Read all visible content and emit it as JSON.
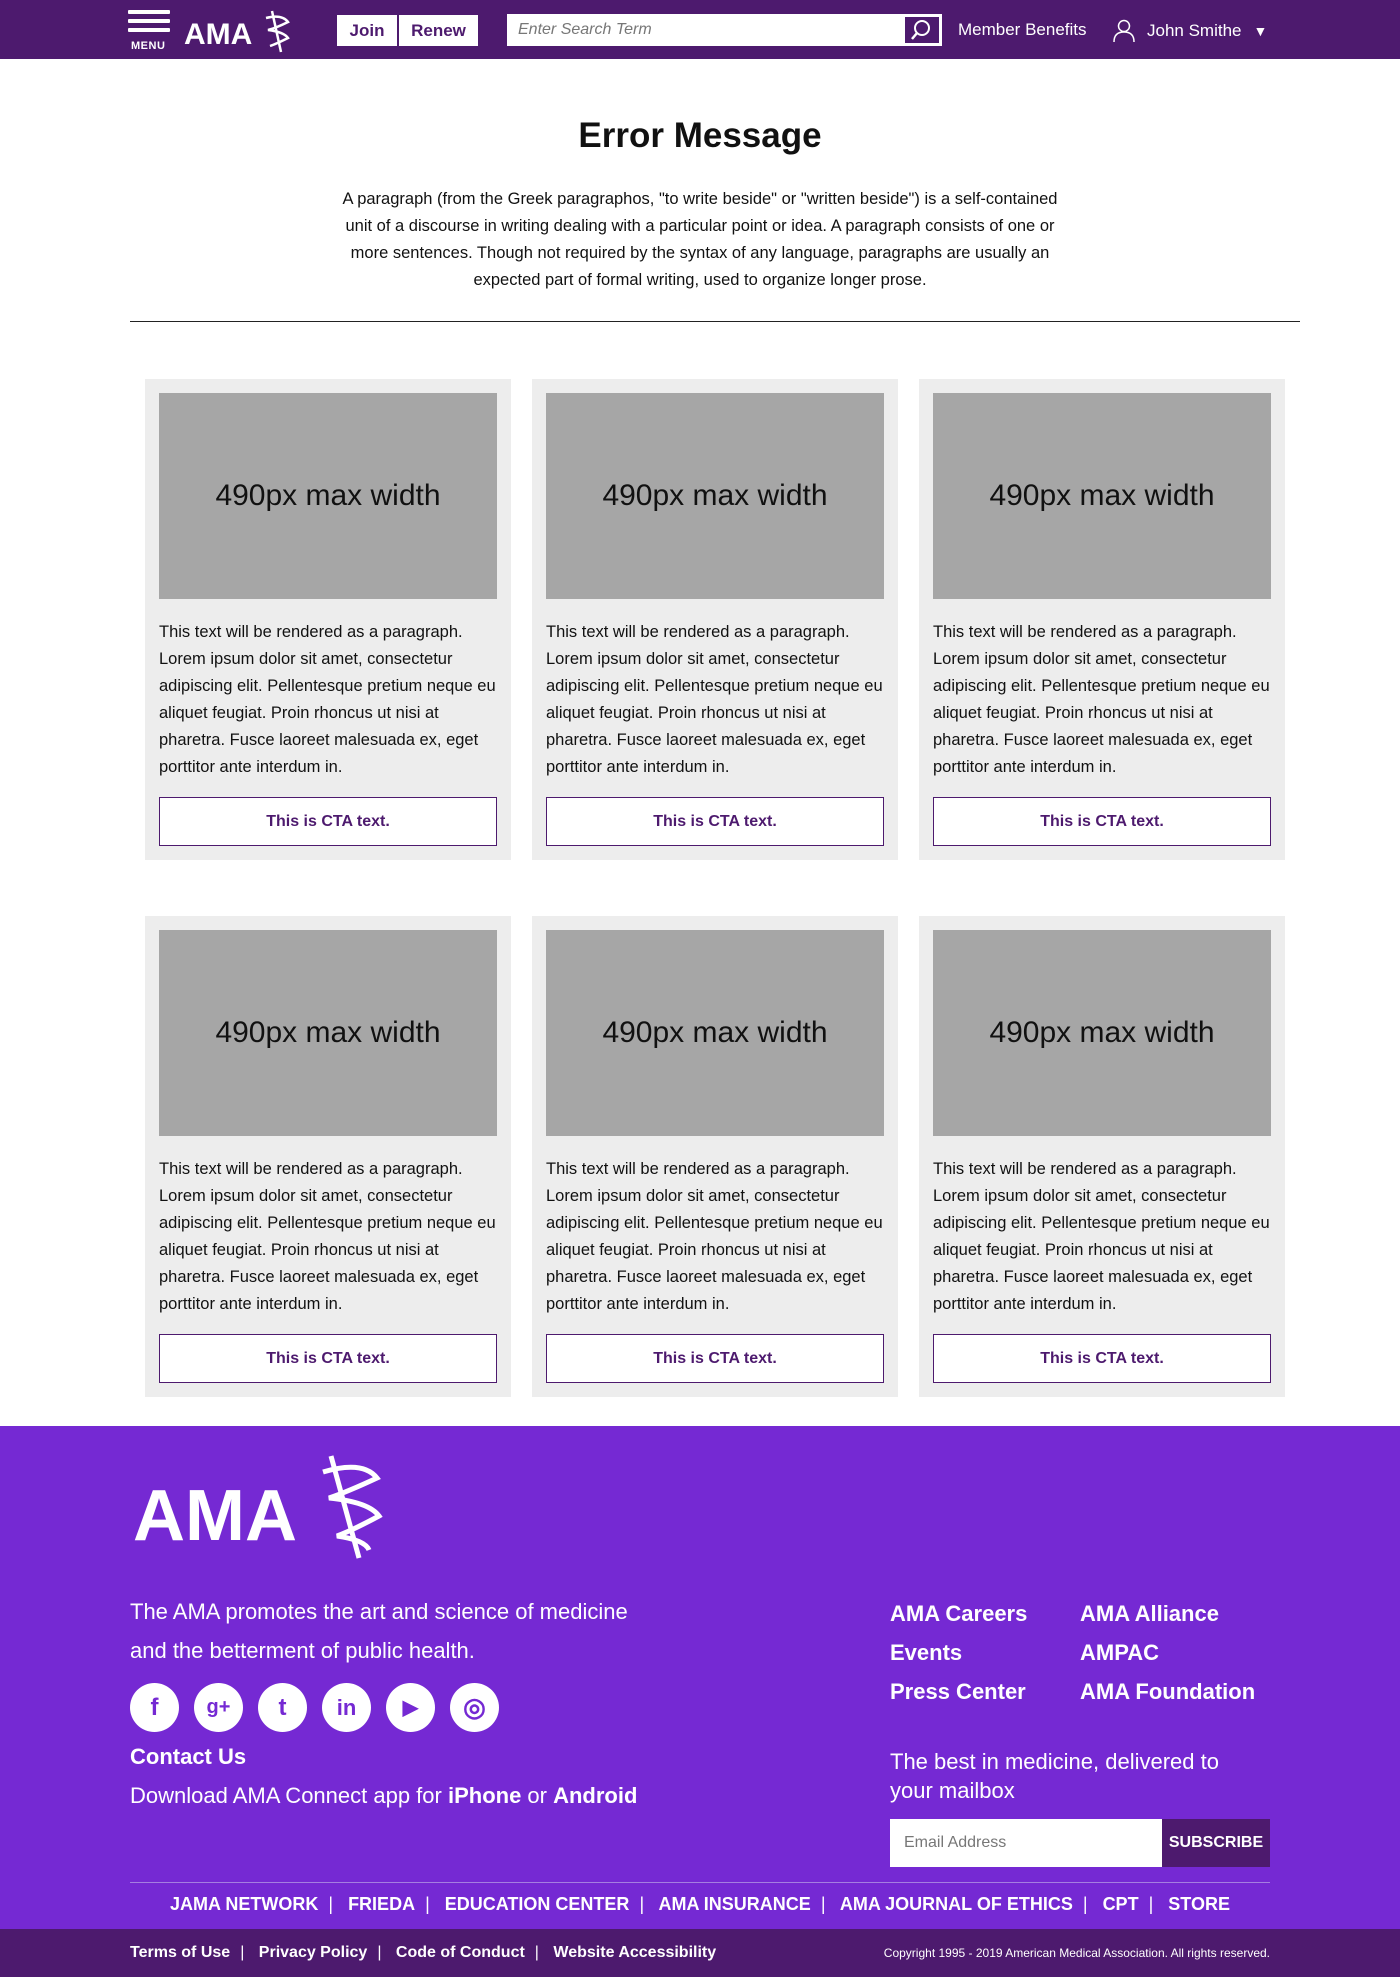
{
  "header": {
    "menu_label": "MENU",
    "logo_text": "AMA",
    "join_label": "Join",
    "renew_label": "Renew",
    "search_placeholder": "Enter Search Term",
    "member_benefits": "Member Benefits",
    "user_name": "John Smithe"
  },
  "main": {
    "title": "Error Message",
    "intro": "A paragraph (from the Greek paragraphos, \"to write beside\" or \"written beside\") is a self-contained unit of a discourse in writing dealing with a particular point or idea. A paragraph consists of one or more sentences. Though not required by the syntax of any language, paragraphs are usually an expected part of formal writing, used to organize longer prose.",
    "cards": [
      {
        "image_label": "490px max width",
        "text": "This text will be rendered as a paragraph. Lorem ipsum dolor sit amet, consectetur adipiscing elit. Pellentesque pretium neque eu aliquet feugiat. Proin rhoncus ut nisi at pharetra. Fusce laoreet malesuada ex, eget porttitor ante interdum in.",
        "cta": "This is CTA text."
      },
      {
        "image_label": "490px max width",
        "text": "This text will be rendered as a paragraph. Lorem ipsum dolor sit amet, consectetur adipiscing elit. Pellentesque pretium neque eu aliquet feugiat. Proin rhoncus ut nisi at pharetra. Fusce laoreet malesuada ex, eget porttitor ante interdum in.",
        "cta": "This is CTA text."
      },
      {
        "image_label": "490px max width",
        "text": "This text will be rendered as a paragraph. Lorem ipsum dolor sit amet, consectetur adipiscing elit. Pellentesque pretium neque eu aliquet feugiat. Proin rhoncus ut nisi at pharetra. Fusce laoreet malesuada ex, eget porttitor ante interdum in.",
        "cta": "This is CTA text."
      },
      {
        "image_label": "490px max width",
        "text": "This text will be rendered as a paragraph. Lorem ipsum dolor sit amet, consectetur adipiscing elit. Pellentesque pretium neque eu aliquet feugiat. Proin rhoncus ut nisi at pharetra. Fusce laoreet malesuada ex, eget porttitor ante interdum in.",
        "cta": "This is CTA text."
      },
      {
        "image_label": "490px max width",
        "text": "This text will be rendered as a paragraph. Lorem ipsum dolor sit amet, consectetur adipiscing elit. Pellentesque pretium neque eu aliquet feugiat. Proin rhoncus ut nisi at pharetra. Fusce laoreet malesuada ex, eget porttitor ante interdum in.",
        "cta": "This is CTA text."
      },
      {
        "image_label": "490px max width",
        "text": "This text will be rendered as a paragraph. Lorem ipsum dolor sit amet, consectetur adipiscing elit. Pellentesque pretium neque eu aliquet feugiat. Proin rhoncus ut nisi at pharetra. Fusce laoreet malesuada ex, eget porttitor ante interdum in.",
        "cta": "This is CTA text."
      }
    ]
  },
  "footer": {
    "logo_text": "AMA",
    "tagline": "The AMA promotes the art and science of medicine and the betterment of public health.",
    "socials": [
      {
        "name": "facebook-icon",
        "glyph": "f"
      },
      {
        "name": "google-plus-icon",
        "glyph": "g+"
      },
      {
        "name": "twitter-icon",
        "glyph": "t"
      },
      {
        "name": "linkedin-icon",
        "glyph": "in"
      },
      {
        "name": "youtube-icon",
        "glyph": "▶"
      },
      {
        "name": "instagram-icon",
        "glyph": "◎"
      }
    ],
    "contact": "Contact Us",
    "download_prefix": "Download AMA Connect app for ",
    "iphone": "iPhone",
    "download_or": " or ",
    "android": "Android",
    "links_col1": [
      "AMA Careers",
      "Events",
      "Press Center"
    ],
    "links_col2": [
      "AMA Alliance",
      "AMPAC",
      "AMA Foundation"
    ],
    "newsletter_heading": "The best in medicine, delivered to your mailbox",
    "email_placeholder": "Email Address",
    "subscribe_label": "SUBSCRIBE",
    "sister_links": [
      "JAMA NETWORK",
      "FRIEDA",
      "EDUCATION CENTER",
      "AMA INSURANCE",
      "AMA JOURNAL OF ETHICS",
      "CPT",
      "STORE"
    ],
    "legal_links": [
      "Terms of Use",
      "Privacy Policy",
      "Code of Conduct",
      "Website Accessibility"
    ],
    "copyright": "Copyright 1995 - 2019 American Medical Association. All rights reserved."
  },
  "colors": {
    "header_purple": "#4d1a6e",
    "footer_purple": "#7529d3",
    "card_bg": "#ededed",
    "image_placeholder": "#a6a6a6"
  }
}
